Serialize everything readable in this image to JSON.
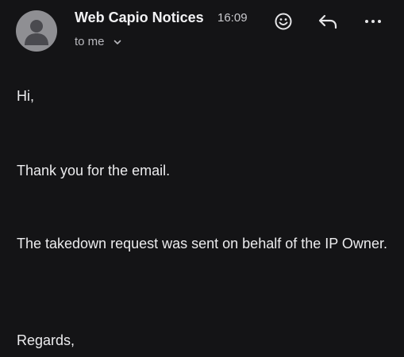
{
  "header": {
    "sender": "Web Capio Notices",
    "time": "16:09",
    "recipient": "to me",
    "avatar_icon": "person-silhouette-icon",
    "actions": [
      {
        "icon": "emoji-smile-icon"
      },
      {
        "icon": "reply-arrow-icon"
      },
      {
        "icon": "more-horizontal-icon"
      }
    ]
  },
  "message": {
    "greeting": "Hi,",
    "line1": "Thank you for the email.",
    "line2": "The takedown request was sent on behalf of the IP Owner.",
    "closing": "Regards,"
  },
  "colors": {
    "background": "#141416",
    "text": "#ececee",
    "avatar": "#8f8f93"
  }
}
